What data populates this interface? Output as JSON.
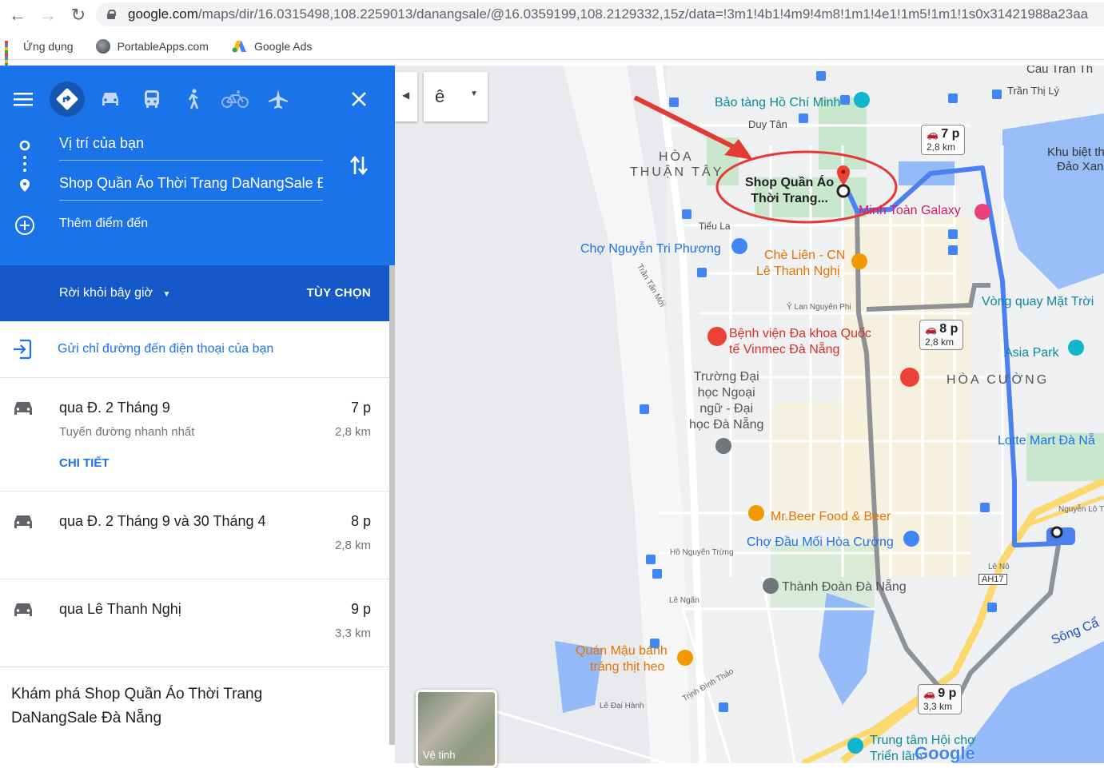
{
  "browser": {
    "url_host": "google.com",
    "url_rest": "/maps/dir/16.0315498,108.2259013/danangsale/@16.0359199,108.2129332,15z/data=!3m1!4b1!4m9!4m8!1m1!4e1!1m5!1m1!1s0x31421988a23aa",
    "bookmarks": [
      {
        "label": "Ứng dụng",
        "icon": "apps-grid-icon"
      },
      {
        "label": "PortableApps.com",
        "icon": "globe-icon"
      },
      {
        "label": "Google Ads",
        "icon": "google-ads-icon"
      }
    ]
  },
  "panel": {
    "origin": "Vị trí của bạn",
    "destination": "Shop Quần Áo Thời Trang DaNangSale Đà Nẵng",
    "add_destination": "Thêm điểm đến",
    "leave_now": "Rời khỏi bây giờ",
    "options": "TÙY CHỌN",
    "send_to_phone": "Gửi chỉ đường đến điện thoại của bạn",
    "routes": [
      {
        "name": "qua Đ. 2 Tháng 9",
        "subtitle": "Tuyến đường nhanh nhất",
        "time": "7 p",
        "distance": "2,8 km",
        "details": "CHI TIẾT"
      },
      {
        "name": "qua Đ. 2 Tháng 9 và 30 Tháng 4",
        "time": "8 p",
        "distance": "2,8 km"
      },
      {
        "name": "qua Lê Thanh Nghị",
        "time": "9 p",
        "distance": "3,3 km"
      }
    ],
    "explore": "Khám phá Shop Quần Áo Thời Trang DaNangSale Đà Nẵng"
  },
  "map": {
    "layer_control": "ê",
    "satellite_label": "Vệ tinh",
    "logo": "Google",
    "destination_label": [
      "Shop Quần Áo",
      "Thời Trang..."
    ],
    "route_boxes": [
      {
        "time": "7 p",
        "distance": "2,8 km"
      },
      {
        "time": "8 p",
        "distance": "2,8 km"
      },
      {
        "time": "9 p",
        "distance": "3,3 km"
      }
    ],
    "places": {
      "bao_tang": "Bảo tàng Hồ Chí Minh",
      "duy_tan": "Duy Tân",
      "hoa_thuan_tay_1": "HÒA",
      "hoa_thuan_tay_2": "THUẬN TÂY",
      "minh_toan": "Minh Toàn Galaxy",
      "cho_nguyen": "Chợ Nguyễn Tri Phương",
      "che_lien_1": "Chè Liên - CN",
      "che_lien_2": "Lê Thanh Nghị",
      "vong_quay": "Vòng quay Mặt Trời",
      "benh_vien_1": "Bệnh viện Đa khoa Quốc",
      "benh_vien_2": "tế Vinmec Đà Nẵng",
      "asia_park": "Asia Park",
      "hoa_cuong": "HÒA CƯỜNG",
      "truong_1": "Trường Đại",
      "truong_2": "học Ngoại",
      "truong_3": "ngữ - Đại",
      "truong_4": "học Đà Nẵng",
      "lotte": "Lotte Mart Đà Nẵ",
      "mr_beer": "Mr.Beer Food & Beer",
      "cho_dau_moi": "Chợ Đầu Mối Hòa Cường",
      "thanh_doan": "Thành Đoàn Đà Nẵng",
      "quan_mau_1": "Quán Mậu bánh",
      "quan_mau_2": "tráng thịt heo",
      "trung_tam_1": "Trung tâm Hội chợ",
      "trung_tam_2": "Triển lãm",
      "khu_biet_1": "Khu biệt th",
      "khu_biet_2": "Đảo Xan",
      "song": "Sông Cẩ",
      "tran_thi_ly": "Trần Thị Lý",
      "cau_tran": "Cầu Trần Th",
      "tieu_la": "Tiểu La",
      "ah17": "AH17",
      "tran_tan_moi": "Trần Tấn Mới",
      "y_lan": "Ỷ Lan Nguyên Phi",
      "nguyen_loi": "Nguyễn Lộ T",
      "ho_nguyen": "Hồ Nguyên Trừng",
      "le_ngan": "Lê Ngân",
      "le_dai_hanh": "Lê Đại Hành",
      "trinh_dinh": "Trịnh Đình Thảo",
      "le_no": "Lê Nô"
    }
  }
}
